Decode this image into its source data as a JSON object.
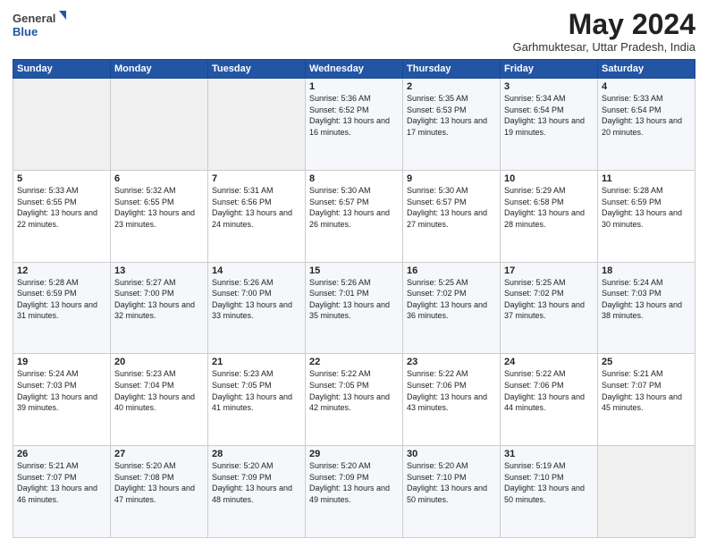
{
  "header": {
    "logo_general": "General",
    "logo_blue": "Blue",
    "month_title": "May 2024",
    "location": "Garhmuktesar, Uttar Pradesh, India"
  },
  "days_of_week": [
    "Sunday",
    "Monday",
    "Tuesday",
    "Wednesday",
    "Thursday",
    "Friday",
    "Saturday"
  ],
  "weeks": [
    [
      {
        "day": "",
        "sunrise": "",
        "sunset": "",
        "daylight": ""
      },
      {
        "day": "",
        "sunrise": "",
        "sunset": "",
        "daylight": ""
      },
      {
        "day": "",
        "sunrise": "",
        "sunset": "",
        "daylight": ""
      },
      {
        "day": "1",
        "sunrise": "Sunrise: 5:36 AM",
        "sunset": "Sunset: 6:52 PM",
        "daylight": "Daylight: 13 hours and 16 minutes."
      },
      {
        "day": "2",
        "sunrise": "Sunrise: 5:35 AM",
        "sunset": "Sunset: 6:53 PM",
        "daylight": "Daylight: 13 hours and 17 minutes."
      },
      {
        "day": "3",
        "sunrise": "Sunrise: 5:34 AM",
        "sunset": "Sunset: 6:54 PM",
        "daylight": "Daylight: 13 hours and 19 minutes."
      },
      {
        "day": "4",
        "sunrise": "Sunrise: 5:33 AM",
        "sunset": "Sunset: 6:54 PM",
        "daylight": "Daylight: 13 hours and 20 minutes."
      }
    ],
    [
      {
        "day": "5",
        "sunrise": "Sunrise: 5:33 AM",
        "sunset": "Sunset: 6:55 PM",
        "daylight": "Daylight: 13 hours and 22 minutes."
      },
      {
        "day": "6",
        "sunrise": "Sunrise: 5:32 AM",
        "sunset": "Sunset: 6:55 PM",
        "daylight": "Daylight: 13 hours and 23 minutes."
      },
      {
        "day": "7",
        "sunrise": "Sunrise: 5:31 AM",
        "sunset": "Sunset: 6:56 PM",
        "daylight": "Daylight: 13 hours and 24 minutes."
      },
      {
        "day": "8",
        "sunrise": "Sunrise: 5:30 AM",
        "sunset": "Sunset: 6:57 PM",
        "daylight": "Daylight: 13 hours and 26 minutes."
      },
      {
        "day": "9",
        "sunrise": "Sunrise: 5:30 AM",
        "sunset": "Sunset: 6:57 PM",
        "daylight": "Daylight: 13 hours and 27 minutes."
      },
      {
        "day": "10",
        "sunrise": "Sunrise: 5:29 AM",
        "sunset": "Sunset: 6:58 PM",
        "daylight": "Daylight: 13 hours and 28 minutes."
      },
      {
        "day": "11",
        "sunrise": "Sunrise: 5:28 AM",
        "sunset": "Sunset: 6:59 PM",
        "daylight": "Daylight: 13 hours and 30 minutes."
      }
    ],
    [
      {
        "day": "12",
        "sunrise": "Sunrise: 5:28 AM",
        "sunset": "Sunset: 6:59 PM",
        "daylight": "Daylight: 13 hours and 31 minutes."
      },
      {
        "day": "13",
        "sunrise": "Sunrise: 5:27 AM",
        "sunset": "Sunset: 7:00 PM",
        "daylight": "Daylight: 13 hours and 32 minutes."
      },
      {
        "day": "14",
        "sunrise": "Sunrise: 5:26 AM",
        "sunset": "Sunset: 7:00 PM",
        "daylight": "Daylight: 13 hours and 33 minutes."
      },
      {
        "day": "15",
        "sunrise": "Sunrise: 5:26 AM",
        "sunset": "Sunset: 7:01 PM",
        "daylight": "Daylight: 13 hours and 35 minutes."
      },
      {
        "day": "16",
        "sunrise": "Sunrise: 5:25 AM",
        "sunset": "Sunset: 7:02 PM",
        "daylight": "Daylight: 13 hours and 36 minutes."
      },
      {
        "day": "17",
        "sunrise": "Sunrise: 5:25 AM",
        "sunset": "Sunset: 7:02 PM",
        "daylight": "Daylight: 13 hours and 37 minutes."
      },
      {
        "day": "18",
        "sunrise": "Sunrise: 5:24 AM",
        "sunset": "Sunset: 7:03 PM",
        "daylight": "Daylight: 13 hours and 38 minutes."
      }
    ],
    [
      {
        "day": "19",
        "sunrise": "Sunrise: 5:24 AM",
        "sunset": "Sunset: 7:03 PM",
        "daylight": "Daylight: 13 hours and 39 minutes."
      },
      {
        "day": "20",
        "sunrise": "Sunrise: 5:23 AM",
        "sunset": "Sunset: 7:04 PM",
        "daylight": "Daylight: 13 hours and 40 minutes."
      },
      {
        "day": "21",
        "sunrise": "Sunrise: 5:23 AM",
        "sunset": "Sunset: 7:05 PM",
        "daylight": "Daylight: 13 hours and 41 minutes."
      },
      {
        "day": "22",
        "sunrise": "Sunrise: 5:22 AM",
        "sunset": "Sunset: 7:05 PM",
        "daylight": "Daylight: 13 hours and 42 minutes."
      },
      {
        "day": "23",
        "sunrise": "Sunrise: 5:22 AM",
        "sunset": "Sunset: 7:06 PM",
        "daylight": "Daylight: 13 hours and 43 minutes."
      },
      {
        "day": "24",
        "sunrise": "Sunrise: 5:22 AM",
        "sunset": "Sunset: 7:06 PM",
        "daylight": "Daylight: 13 hours and 44 minutes."
      },
      {
        "day": "25",
        "sunrise": "Sunrise: 5:21 AM",
        "sunset": "Sunset: 7:07 PM",
        "daylight": "Daylight: 13 hours and 45 minutes."
      }
    ],
    [
      {
        "day": "26",
        "sunrise": "Sunrise: 5:21 AM",
        "sunset": "Sunset: 7:07 PM",
        "daylight": "Daylight: 13 hours and 46 minutes."
      },
      {
        "day": "27",
        "sunrise": "Sunrise: 5:20 AM",
        "sunset": "Sunset: 7:08 PM",
        "daylight": "Daylight: 13 hours and 47 minutes."
      },
      {
        "day": "28",
        "sunrise": "Sunrise: 5:20 AM",
        "sunset": "Sunset: 7:09 PM",
        "daylight": "Daylight: 13 hours and 48 minutes."
      },
      {
        "day": "29",
        "sunrise": "Sunrise: 5:20 AM",
        "sunset": "Sunset: 7:09 PM",
        "daylight": "Daylight: 13 hours and 49 minutes."
      },
      {
        "day": "30",
        "sunrise": "Sunrise: 5:20 AM",
        "sunset": "Sunset: 7:10 PM",
        "daylight": "Daylight: 13 hours and 50 minutes."
      },
      {
        "day": "31",
        "sunrise": "Sunrise: 5:19 AM",
        "sunset": "Sunset: 7:10 PM",
        "daylight": "Daylight: 13 hours and 50 minutes."
      },
      {
        "day": "",
        "sunrise": "",
        "sunset": "",
        "daylight": ""
      }
    ]
  ]
}
